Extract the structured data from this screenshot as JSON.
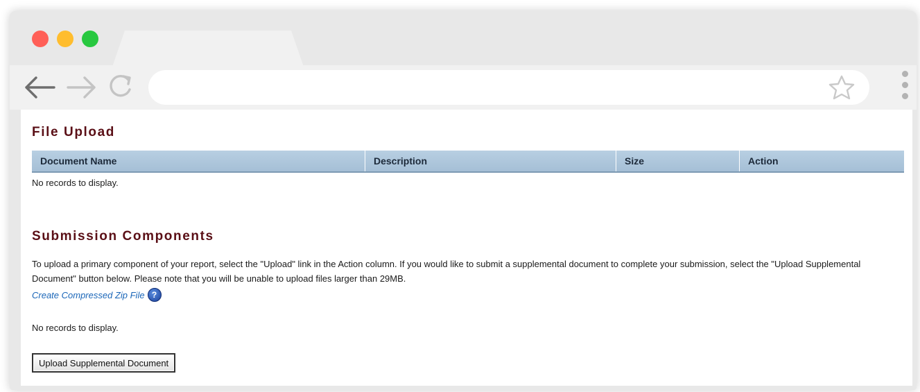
{
  "colors": {
    "heading": "#5a0f16",
    "link": "#1a66b8",
    "grid_header": "#b8cfe2",
    "traffic_red": "#ff5f57",
    "traffic_yellow": "#ffbd2e",
    "traffic_green": "#28c840"
  },
  "browser": {
    "address": "",
    "icons": [
      "back-arrow-icon",
      "forward-arrow-icon",
      "reload-icon",
      "star-icon",
      "menu-kebab-icon"
    ]
  },
  "file_upload": {
    "title": "File Upload",
    "columns": [
      "Document Name",
      "Description",
      "Size",
      "Action"
    ],
    "empty_text": "No records to display."
  },
  "submission": {
    "title": "Submission Components",
    "instructions": "To upload a primary component of your report, select the \"Upload\" link in the Action column. If you would like to submit a supplemental document to complete your submission, select the \"Upload Supplemental Document\" button below. Please note that you will be unable to upload files larger than 29MB.",
    "zip_link": "Create Compressed Zip File",
    "help_glyph": "?",
    "empty_text": "No records to display.",
    "upload_button": "Upload Supplemental Document"
  }
}
